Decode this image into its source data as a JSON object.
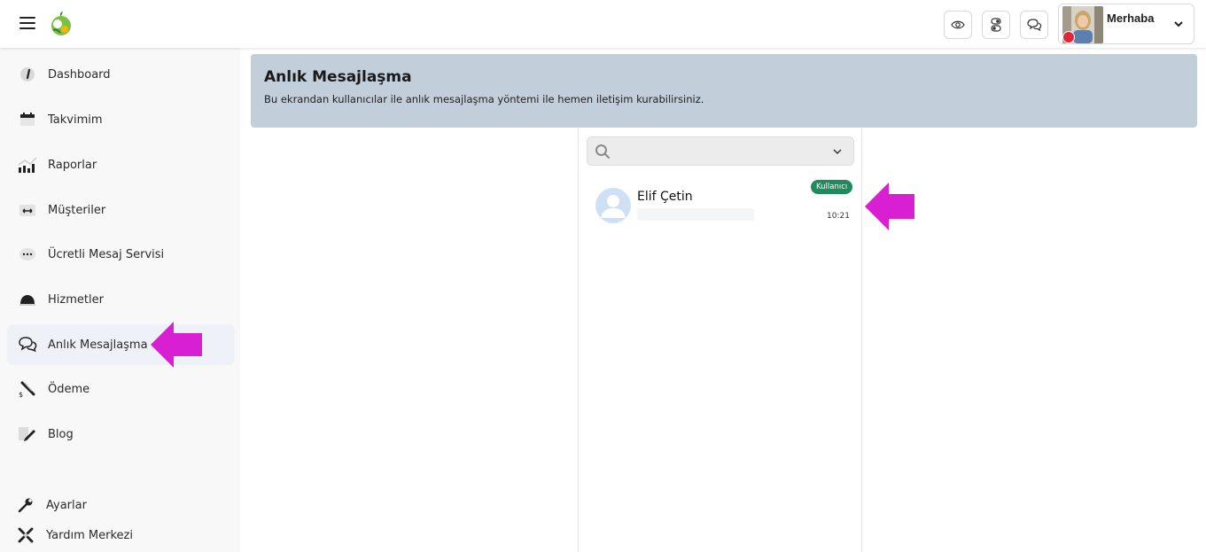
{
  "header": {
    "greeting": "Merhaba",
    "buttons": [
      "eye-icon",
      "toggle-icon",
      "chat-icon"
    ],
    "status_color": "#e0263a"
  },
  "sidebar": {
    "items": [
      {
        "label": "Dashboard",
        "icon": "gauge-icon"
      },
      {
        "label": "Takvimim",
        "icon": "calendar-icon"
      },
      {
        "label": "Raporlar",
        "icon": "bar-chart-icon"
      },
      {
        "label": "Müşteriler",
        "icon": "customers-icon"
      },
      {
        "label": "Ücretli Mesaj Servisi",
        "icon": "message-dots-icon"
      },
      {
        "label": "Hizmetler",
        "icon": "cloche-icon"
      },
      {
        "label": "Anlık Mesajlaşma",
        "icon": "chat-bubbles-icon",
        "active": true
      },
      {
        "label": "Ödeme",
        "icon": "payment-icon"
      },
      {
        "label": "Blog",
        "icon": "blog-pen-icon"
      }
    ],
    "bottom_items": [
      {
        "label": "Ayarlar",
        "icon": "wrench-icon"
      },
      {
        "label": "Yardım Merkezi",
        "icon": "help-center-icon"
      }
    ]
  },
  "page": {
    "title": "Anlık Mesajlaşma",
    "subtitle": "Bu ekrandan kullanıcılar ile anlık mesajlaşma yöntemi ile hemen iletişim kurabilirsiniz."
  },
  "chat": {
    "search_placeholder": "",
    "conversations": [
      {
        "name": "Elif Çetin",
        "badge": "Kullanıcı",
        "time": "10:21",
        "badge_color": "#1f8a5c"
      }
    ]
  },
  "colors": {
    "header_bg": "#c2ceda",
    "annotation_arrow": "#d81fd2",
    "sidebar_active_bg": "#eef2f8"
  }
}
